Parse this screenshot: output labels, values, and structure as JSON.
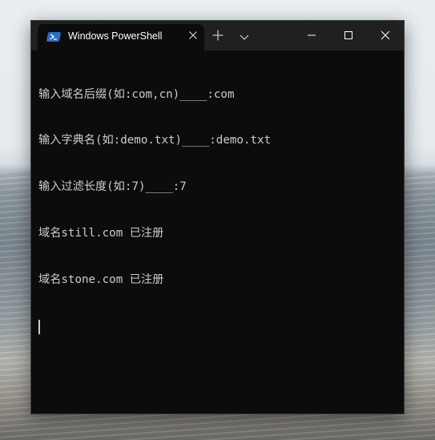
{
  "window": {
    "tab_title": "Windows PowerShell"
  },
  "terminal": {
    "lines": [
      "输入域名后缀(如:com,cn)____:com",
      "输入字典名(如:demo.txt)____:demo.txt",
      "输入过滤长度(如:7)____:7",
      "域名still.com 已注册",
      "域名stone.com 已注册"
    ]
  },
  "colors": {
    "titlebar": "#202020",
    "terminal_bg": "#0c0c0c",
    "terminal_fg": "#cccccc",
    "powershell_icon": "#2a6fc9"
  },
  "icons": {
    "tab": "powershell-icon",
    "close_tab": "close-icon",
    "new_tab": "plus-icon",
    "dropdown": "chevron-down-icon",
    "minimize": "minimize-icon",
    "maximize": "maximize-icon",
    "close": "close-icon"
  }
}
